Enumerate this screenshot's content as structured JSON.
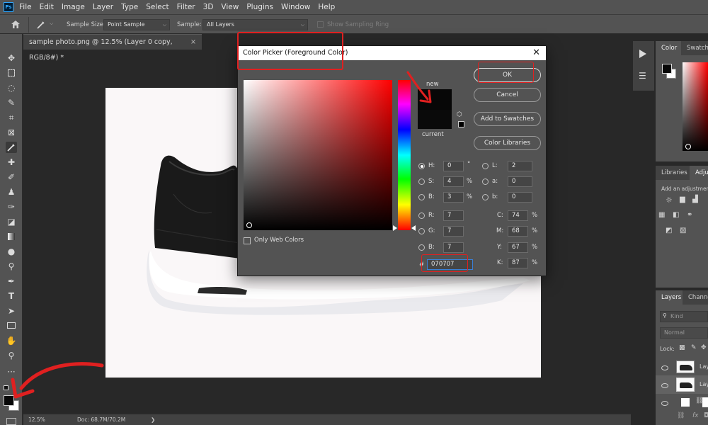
{
  "app": {
    "logo_text": "Ps"
  },
  "menu": [
    "File",
    "Edit",
    "Image",
    "Layer",
    "Type",
    "Select",
    "Filter",
    "3D",
    "View",
    "Plugins",
    "Window",
    "Help"
  ],
  "options": {
    "sample_size_label": "Sample Size:",
    "sample_size_value": "Point Sample",
    "sample_label": "Sample:",
    "sample_value": "All Layers",
    "show_ring_label": "Show Sampling Ring"
  },
  "document": {
    "tab_title": "sample photo.png @ 12.5% (Layer 0 copy, RGB/8#) *",
    "zoom": "12.5%",
    "doc_size": "Doc: 68.7M/70.2M"
  },
  "dialog": {
    "title": "Color Picker (Foreground Color)",
    "new_label": "new",
    "current_label": "current",
    "only_web_colors_label": "Only Web Colors",
    "buttons": {
      "ok": "OK",
      "cancel": "Cancel",
      "add_to_swatches": "Add to Swatches",
      "color_libraries": "Color Libraries"
    },
    "hsb": {
      "h_label": "H:",
      "h": "0",
      "h_unit": "°",
      "s_label": "S:",
      "s": "4",
      "s_unit": "%",
      "b_label": "B:",
      "b": "3",
      "b_unit": "%"
    },
    "rgb": {
      "r_label": "R:",
      "r": "7",
      "g_label": "G:",
      "g": "7",
      "b_label": "B:",
      "b": "7"
    },
    "lab": {
      "l_label": "L:",
      "l": "2",
      "a_label": "a:",
      "a": "0",
      "b_label": "b:",
      "b": "0"
    },
    "cmyk": {
      "c_label": "C:",
      "c": "74",
      "m_label": "M:",
      "m": "68",
      "y_label": "Y:",
      "y": "67",
      "k_label": "K:",
      "k": "87",
      "unit": "%"
    },
    "hex_label": "#",
    "hex": "070707",
    "new_color": "#070707"
  },
  "panels": {
    "color_tab": "Color",
    "swatches_tab": "Swatche",
    "libraries_tab": "Libraries",
    "adjustments_tab": "Adju",
    "add_adjustment": "Add an adjustmen",
    "layers_tab": "Layers",
    "channels_tab": "Channe",
    "kind_placeholder": "Kind",
    "blend_mode": "Normal",
    "lock_label": "Lock:",
    "layer_1": "Lay",
    "layer_2": "Lay"
  },
  "colors": {
    "accent_red": "#e02020",
    "ui_dark": "#535353",
    "canvas_bg": "#282828"
  }
}
